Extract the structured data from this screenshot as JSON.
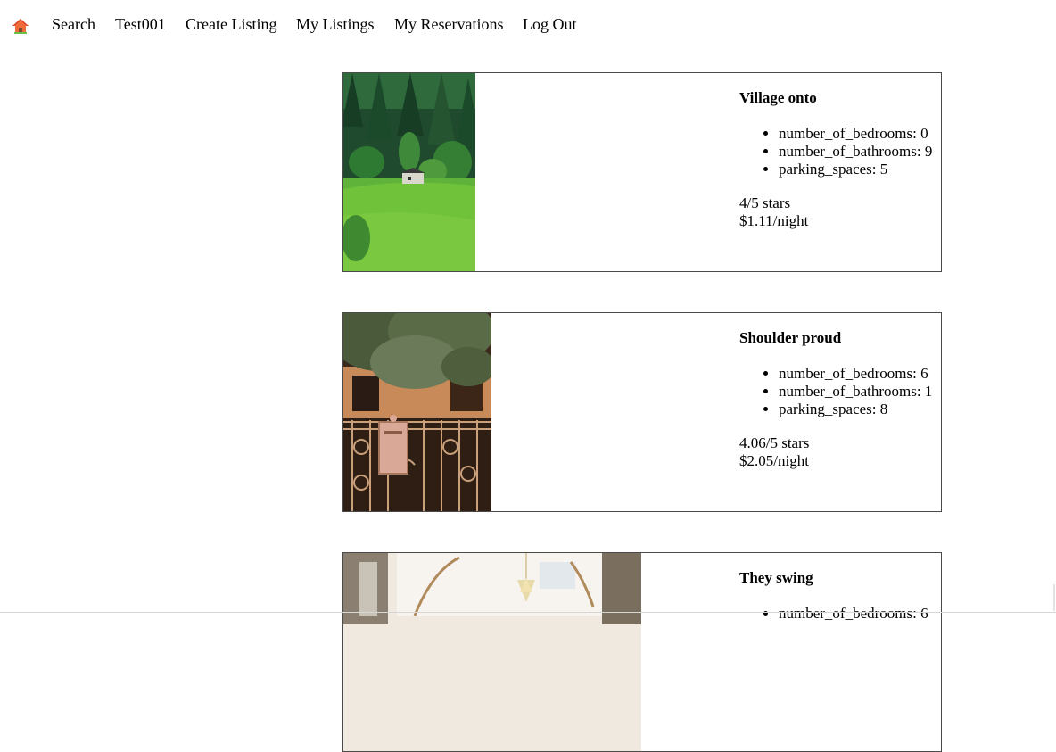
{
  "nav": {
    "home_icon": "home-icon",
    "links": [
      "Search",
      "Test001",
      "Create Listing",
      "My Listings",
      "My Reservations",
      "Log Out"
    ]
  },
  "listings": [
    {
      "title": "Village onto",
      "features": [
        "number_of_bedrooms: 0",
        "number_of_bathrooms: 9",
        "parking_spaces: 5"
      ],
      "rating": "4/5 stars",
      "price": "$1.11/night",
      "image": "forest-cabin-photo"
    },
    {
      "title": "Shoulder proud",
      "features": [
        "number_of_bedrooms: 6",
        "number_of_bathrooms: 1",
        "parking_spaces: 8"
      ],
      "rating": "4.06/5 stars",
      "price": "$2.05/night",
      "image": "gate-mailbox-photo"
    },
    {
      "title": "They swing",
      "features": [
        "number_of_bedrooms: 6"
      ],
      "image": "staircase-chandelier-photo"
    }
  ]
}
